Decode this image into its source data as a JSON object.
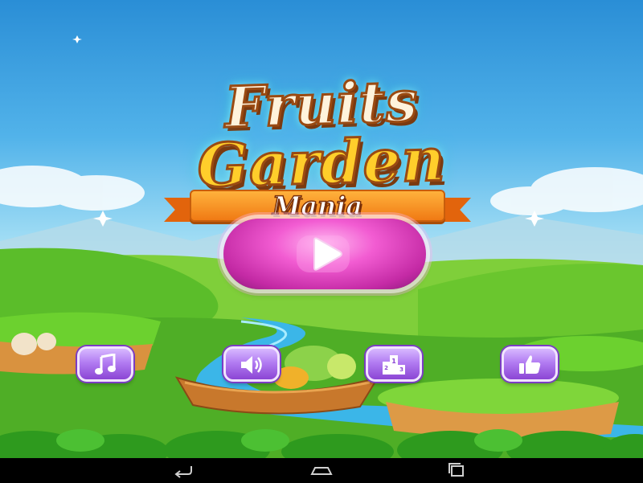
{
  "game": {
    "title_line1": "Fruits",
    "title_line2": "Garden",
    "subtitle": "Mania"
  },
  "menu": {
    "play_icon": "play-icon",
    "buttons": [
      {
        "id": "music",
        "icon": "music-note-icon"
      },
      {
        "id": "sound",
        "icon": "speaker-icon"
      },
      {
        "id": "leaderboard",
        "icon": "podium-icon"
      },
      {
        "id": "like",
        "icon": "thumbs-up-icon"
      }
    ]
  },
  "navbar": {
    "buttons": [
      "back-icon",
      "home-icon",
      "recent-apps-icon"
    ]
  },
  "colors": {
    "play_button": "#e24bc6",
    "menu_button": "#a867ea",
    "title_yellow": "#ffce2b",
    "ribbon": "#f28a1e"
  }
}
